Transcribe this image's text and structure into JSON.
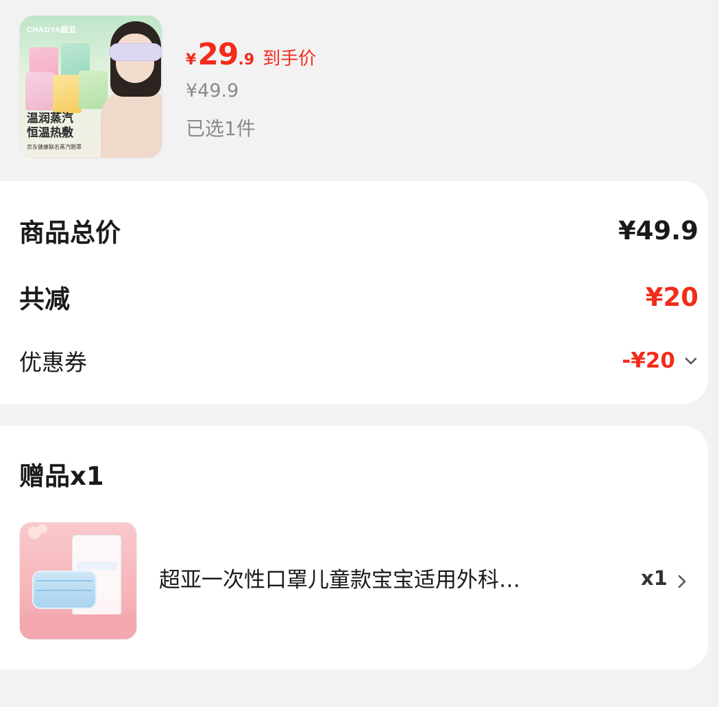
{
  "product": {
    "image_brand": "CHAOYA超亚",
    "image_text_line1": "温润蒸汽",
    "image_text_line2": "恒温热敷",
    "image_subtext": "京东健康联名蒸汽眼罩",
    "final_price_symbol": "¥",
    "final_price_int": "29",
    "final_price_dec": ".9",
    "final_price_tag": "到手价",
    "original_price": "¥49.9",
    "selected_count": "已选1件"
  },
  "summary": {
    "total_label": "商品总价",
    "total_value": "¥49.9",
    "discount_label": "共减",
    "discount_value": "¥20",
    "coupon_label": "优惠券",
    "coupon_value": "-¥20"
  },
  "gift": {
    "title": "赠品x1",
    "item_name": "超亚一次性口罩儿童款宝宝适用外科…",
    "item_qty": "x1"
  },
  "colors": {
    "accent_red": "#f22c1b",
    "page_bg": "#f2f2f2",
    "card_bg": "#ffffff",
    "muted_text": "#8a8a8a"
  },
  "icons": {
    "coupon_expand": "chevron-down-icon",
    "gift_detail": "chevron-right-icon"
  }
}
